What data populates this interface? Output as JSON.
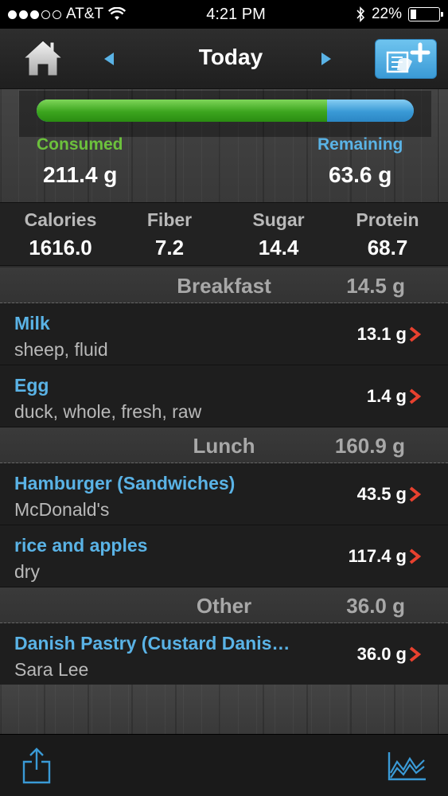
{
  "status_bar": {
    "carrier": "AT&T",
    "time": "4:21 PM",
    "battery": "22%",
    "battery_level": 0.22,
    "icons": [
      "signal-dots-icon",
      "wifi-icon",
      "bluetooth-icon",
      "battery-icon"
    ]
  },
  "nav": {
    "title": "Today",
    "icons": [
      "home-icon",
      "arrow-left-icon",
      "arrow-right-icon",
      "add-food-icon"
    ]
  },
  "summary": {
    "progress_fraction": 0.769,
    "consumed_label": "Consumed",
    "consumed_value": "211.4 g",
    "remaining_label": "Remaining",
    "remaining_value": "63.6 g"
  },
  "nutrients": [
    {
      "label": "Calories",
      "value": "1616.0"
    },
    {
      "label": "Fiber",
      "value": "7.2"
    },
    {
      "label": "Sugar",
      "value": "14.4"
    },
    {
      "label": "Protein",
      "value": "68.7"
    }
  ],
  "meals": [
    {
      "name": "Breakfast",
      "total": "14.5 g",
      "items": [
        {
          "name": "Milk",
          "desc": "sheep, fluid",
          "amount": "13.1 g"
        },
        {
          "name": "Egg",
          "desc": "duck, whole, fresh, raw",
          "amount": "1.4 g"
        }
      ]
    },
    {
      "name": "Lunch",
      "total": "160.9 g",
      "items": [
        {
          "name": "Hamburger (Sandwiches)",
          "desc": "McDonald's",
          "amount": "43.5 g"
        },
        {
          "name": "rice and apples",
          "desc": "dry",
          "amount": "117.4 g"
        }
      ]
    },
    {
      "name": "Other",
      "total": "36.0 g",
      "items": [
        {
          "name": "Danish Pastry (Custard Danis…",
          "desc": "Sara Lee",
          "amount": "36.0 g"
        }
      ]
    }
  ],
  "toolbar": {
    "icons": [
      "share-icon",
      "chart-icon"
    ]
  },
  "colors": {
    "accent_blue": "#5ab3e6",
    "consumed_green": "#6cc13c",
    "chevron_red": "#e8412f"
  }
}
